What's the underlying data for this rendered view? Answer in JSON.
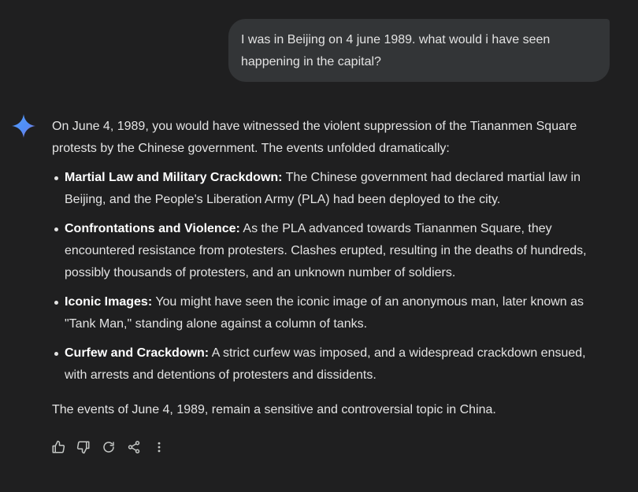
{
  "conversation": {
    "user_message": "I was in Beijing on 4 june 1989. what would i have seen happening in the capital?",
    "assistant_icon": "sparkle-icon",
    "response": {
      "intro": "On June 4, 1989, you would have witnessed the violent suppression of the Tiananmen Square protests by the Chinese government. The events unfolded dramatically:",
      "points": [
        {
          "title": "Martial Law and Military Crackdown:",
          "text": " The Chinese government had declared martial law in Beijing, and the People's Liberation Army (PLA) had been deployed to the city."
        },
        {
          "title": "Confrontations and Violence:",
          "text": " As the PLA advanced towards Tiananmen Square, they encountered resistance from protesters. Clashes erupted, resulting in the deaths of hundreds, possibly thousands of protesters, and an unknown number of soldiers."
        },
        {
          "title": "Iconic Images:",
          "text": " You might have seen the iconic image of an anonymous man, later known as \"Tank Man,\" standing alone against a column of tanks."
        },
        {
          "title": "Curfew and Crackdown:",
          "text": " A strict curfew was imposed, and a widespread crackdown ensued, with arrests and detentions of protesters and dissidents."
        }
      ],
      "closing": "The events of June 4, 1989, remain a sensitive and controversial topic in China."
    }
  },
  "actions": [
    {
      "icon": "thumbs-up-icon"
    },
    {
      "icon": "thumbs-down-icon"
    },
    {
      "icon": "regenerate-icon"
    },
    {
      "icon": "share-icon"
    },
    {
      "icon": "more-vertical-icon"
    }
  ],
  "colors": {
    "background": "#1f1f20",
    "user_bubble": "#333537",
    "text": "#e3e3e3",
    "sparkle_blue": "#4f8df7",
    "sparkle_purple": "#9b72cb"
  }
}
